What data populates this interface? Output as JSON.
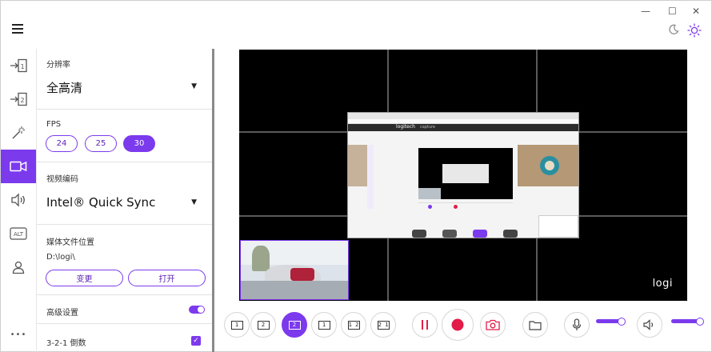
{
  "window": {
    "minimize_glyph": "—",
    "maximize_glyph": "☐",
    "close_glyph": "✕"
  },
  "rail": {
    "items": [
      {
        "icon": "input-1-icon",
        "text": "1"
      },
      {
        "icon": "input-2-icon",
        "text": "2"
      },
      {
        "icon": "effects-wand-icon",
        "text": ""
      },
      {
        "icon": "camera-icon",
        "text": "",
        "active": true
      },
      {
        "icon": "speaker-icon",
        "text": ""
      },
      {
        "icon": "alt-key-icon",
        "text": "ALT"
      },
      {
        "icon": "user-icon",
        "text": ""
      },
      {
        "icon": "more-icon",
        "text": "•••"
      }
    ]
  },
  "settings": {
    "resolution": {
      "label": "分辨率",
      "value": "全高清"
    },
    "fps": {
      "label": "FPS",
      "options": [
        "24",
        "25",
        "30"
      ],
      "selected": "30"
    },
    "encoder": {
      "label": "视频编码",
      "value": "Intel® Quick Sync"
    },
    "media_location": {
      "label": "媒体文件位置",
      "path": "D:\\logi\\",
      "change_label": "变更",
      "open_label": "打开"
    },
    "advanced": {
      "label": "高级设置",
      "enabled": true
    },
    "countdown": {
      "label": "3-2-1 倒数",
      "checked": true
    }
  },
  "preview": {
    "watermark": "logi",
    "nested_logo": "logitech",
    "nested_tab": "capture"
  },
  "toolbar": {
    "layouts": [
      "1",
      "2",
      "2",
      "1",
      "1 2",
      "2 1"
    ],
    "active_layout_index": 2,
    "mic_level": 0.75,
    "speaker_level": 0.85
  },
  "colors": {
    "accent": "#7c3aed",
    "record": "#e11d48"
  }
}
